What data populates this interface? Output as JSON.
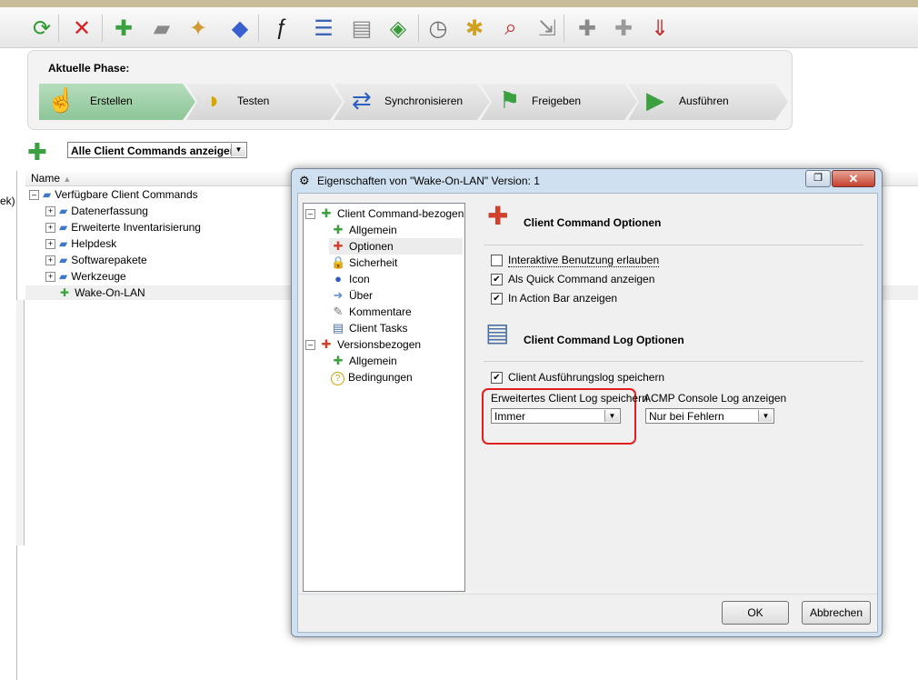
{
  "toolbar": {
    "buttons": [
      {
        "name": "refresh-icon",
        "glyph": "⟳",
        "color": "#2f9a2f"
      },
      {
        "name": "delete-icon",
        "glyph": "✕",
        "color": "#d22222"
      },
      {
        "name": "new-client-command-icon",
        "glyph": "✚",
        "color": "#3aa040"
      },
      {
        "name": "new-folder-icon",
        "glyph": "▰",
        "color": "#8a8a8a"
      },
      {
        "name": "import-icon",
        "glyph": "✦",
        "color": "#d19a32"
      },
      {
        "name": "shapes-icon",
        "glyph": "◆",
        "color": "#3a5fd0"
      },
      {
        "name": "function-icon",
        "glyph": "ƒ",
        "color": "#1a1a1a"
      },
      {
        "name": "properties-icon",
        "glyph": "☰",
        "color": "#3b66b5"
      },
      {
        "name": "comment-icon",
        "glyph": "▤",
        "color": "#8a8a8a"
      },
      {
        "name": "package-icon",
        "glyph": "◈",
        "color": "#3a9a3a"
      },
      {
        "name": "schedule-icon",
        "glyph": "◷",
        "color": "#707070"
      },
      {
        "name": "star-puzzle-icon",
        "glyph": "✱",
        "color": "#d0a020"
      },
      {
        "name": "search-puzzle-icon",
        "glyph": "⌕",
        "color": "#c03030"
      },
      {
        "name": "move-puzzle-icon",
        "glyph": "⇲",
        "color": "#8a8a8a"
      },
      {
        "name": "puzzle-gray-icon",
        "glyph": "✚",
        "color": "#8a8a8a"
      },
      {
        "name": "puzzle-multi-icon",
        "glyph": "✚",
        "color": "#9a9a9a"
      },
      {
        "name": "puzzle-download-icon",
        "glyph": "⇓",
        "color": "#c03030"
      }
    ]
  },
  "phase": {
    "title": "Aktuelle Phase:",
    "steps": [
      {
        "label": "Erstellen",
        "icon": "hand-cursor-icon",
        "glyph": "☝"
      },
      {
        "label": "Testen",
        "icon": "test-icon",
        "glyph": "◑"
      },
      {
        "label": "Synchronisieren",
        "icon": "sync-icon",
        "glyph": "⇄"
      },
      {
        "label": "Freigeben",
        "icon": "release-flag-icon",
        "glyph": "⚑"
      },
      {
        "label": "Ausführen",
        "icon": "execute-play-icon",
        "glyph": "▶"
      }
    ],
    "active_color": "#9fd1a8"
  },
  "filter": {
    "selected": "Alle Client Commands anzeigen"
  },
  "list": {
    "column_name": "Name",
    "partial_text": "ek)",
    "root": "Verfügbare Client Commands",
    "items": [
      "Datenerfassung",
      "Erweiterte Inventarisierung",
      "Helpdesk",
      "Softwarepakete",
      "Werkzeuge",
      "Wake-On-LAN"
    ]
  },
  "dialog": {
    "title": "Eigenschaften von \"Wake-On-LAN\" Version: 1",
    "restore_glyph": "❐",
    "close_glyph": "✕",
    "tree": {
      "group1": "Client Command-bezogen",
      "group1_items": [
        {
          "label": "Allgemein",
          "icon": "puzzle-icon",
          "glyph": "✚",
          "color": "#3aa040"
        },
        {
          "label": "Optionen",
          "icon": "options-icon",
          "glyph": "✚",
          "color": "#d0402d"
        },
        {
          "label": "Sicherheit",
          "icon": "lock-icon",
          "glyph": "🔒",
          "color": "#d8a000"
        },
        {
          "label": "Icon",
          "icon": "user-icon",
          "glyph": "●",
          "color": "#2f5cbf"
        },
        {
          "label": "Über",
          "icon": "arrow-icon",
          "glyph": "➜",
          "color": "#6a8fd0"
        },
        {
          "label": "Kommentare",
          "icon": "pencil-icon",
          "glyph": "✎",
          "color": "#777777"
        },
        {
          "label": "Client Tasks",
          "icon": "page-icon",
          "glyph": "▤",
          "color": "#4a6fa0"
        }
      ],
      "group2": "Versionsbezogen",
      "group2_items": [
        {
          "label": "Allgemein",
          "icon": "puzzle-icon",
          "glyph": "✚",
          "color": "#3aa040"
        },
        {
          "label": "Bedingungen",
          "icon": "question-icon",
          "glyph": "?",
          "color": "#c9a200"
        }
      ]
    },
    "options": {
      "section1_title": "Client Command Optionen",
      "cb_interactive": "Interaktive Benutzung erlauben",
      "cb_quick": "Als Quick Command anzeigen",
      "cb_actionbar": "In Action Bar anzeigen",
      "checked": {
        "interactive": false,
        "quick": true,
        "actionbar": true
      },
      "section2_title": "Client Command Log Optionen",
      "cb_log": "Client Ausführungslog speichern",
      "checked_log": true,
      "ext_log_label": "Erweitertes Client Log speichern",
      "ext_log_value": "Immer",
      "console_log_label": "ACMP Console Log anzeigen",
      "console_log_value": "Nur bei Fehlern"
    },
    "ok": "OK",
    "cancel": "Abbrechen"
  }
}
